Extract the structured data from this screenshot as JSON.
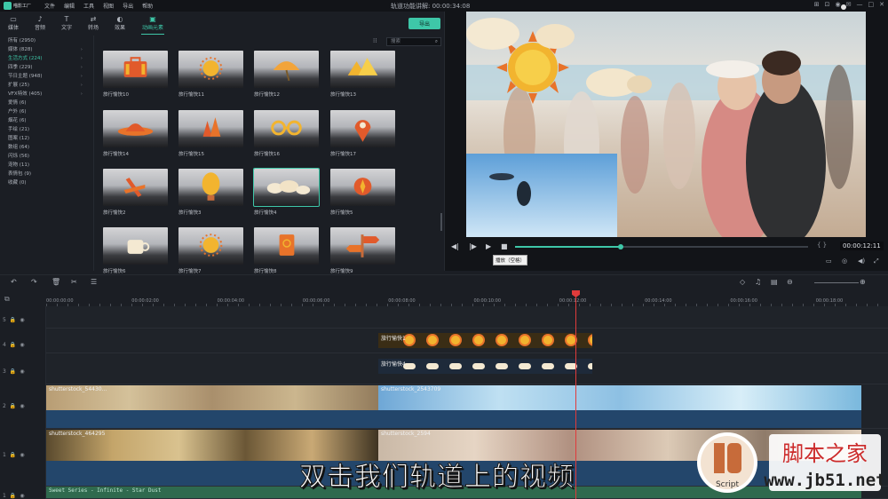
{
  "app": {
    "logo_text": "喵影工厂",
    "menu": [
      "文件",
      "编辑",
      "工具",
      "视图",
      "导出",
      "帮助"
    ],
    "doc_title": "轨道功能讲解: 00:00:34:08",
    "window_icons": [
      "cart-icon",
      "gift-icon",
      "user-icon",
      "mail-icon",
      "minimize-icon",
      "maximize-icon",
      "close-icon"
    ]
  },
  "tabs": [
    {
      "label": "媒体",
      "icon": "folder-icon"
    },
    {
      "label": "音频",
      "icon": "music-icon"
    },
    {
      "label": "文字",
      "icon": "text-icon"
    },
    {
      "label": "转场",
      "icon": "transition-icon"
    },
    {
      "label": "效果",
      "icon": "effects-icon"
    },
    {
      "label": "动画元素",
      "icon": "elements-icon",
      "active": true
    }
  ],
  "export_label": "导出",
  "search": {
    "placeholder": "搜索"
  },
  "categories": [
    {
      "label": "所有 (2950)",
      "arrow": false
    },
    {
      "label": "媒体 (828)",
      "arrow": true
    },
    {
      "label": "生活方式 (224)",
      "arrow": true,
      "active": true
    },
    {
      "label": "四季 (229)",
      "arrow": true
    },
    {
      "label": "节日主题 (948)",
      "arrow": true
    },
    {
      "label": "扩展 (25)",
      "arrow": true
    },
    {
      "label": "VFX特效 (405)",
      "arrow": true
    },
    {
      "label": "爱情 (6)",
      "arrow": false
    },
    {
      "label": "户外 (6)",
      "arrow": false
    },
    {
      "label": "烟花 (6)",
      "arrow": false
    },
    {
      "label": "手绘 (21)",
      "arrow": false
    },
    {
      "label": "图案 (12)",
      "arrow": false
    },
    {
      "label": "数组 (64)",
      "arrow": false
    },
    {
      "label": "闪烁 (56)",
      "arrow": false
    },
    {
      "label": "宠物 (11)",
      "arrow": false
    },
    {
      "label": "表情包 (9)",
      "arrow": false
    },
    {
      "label": "收藏 (0)",
      "arrow": false
    }
  ],
  "elements": [
    {
      "label": "旅行愉快10",
      "icon": "suitcase-icon"
    },
    {
      "label": "旅行愉快11",
      "icon": "sun-icon"
    },
    {
      "label": "旅行愉快12",
      "icon": "umbrella-icon"
    },
    {
      "label": "旅行愉快13",
      "icon": "mountains-icon"
    },
    {
      "label": "旅行愉快14",
      "icon": "hat-icon"
    },
    {
      "label": "旅行愉快15",
      "icon": "trees-icon"
    },
    {
      "label": "旅行愉快16",
      "icon": "sunglasses-icon"
    },
    {
      "label": "旅行愉快17",
      "icon": "location-pin-icon"
    },
    {
      "label": "旅行愉快2",
      "icon": "plane-icon"
    },
    {
      "label": "旅行愉快3",
      "icon": "balloon-icon"
    },
    {
      "label": "旅行愉快4",
      "icon": "clouds-icon",
      "selected": true
    },
    {
      "label": "旅行愉快5",
      "icon": "compass-icon"
    },
    {
      "label": "旅行愉快6",
      "icon": "cup-icon"
    },
    {
      "label": "旅行愉快7",
      "icon": "sun-icon"
    },
    {
      "label": "旅行愉快8",
      "icon": "passport-icon"
    },
    {
      "label": "旅行愉快9",
      "icon": "signpost-icon"
    }
  ],
  "preview": {
    "time": "00:00:12:11",
    "progress": 0.36,
    "tooltip": "播放（空格）",
    "controls": [
      "skip-back-icon",
      "play-back-icon",
      "play-icon",
      "stop-icon"
    ],
    "bottom_icons": [
      "monitor-icon",
      "snapshot-icon",
      "volume-icon",
      "fullscreen-icon"
    ]
  },
  "timeline": {
    "ruler": [
      "00:00:00:00",
      "00:00:02:00",
      "00:00:04:00",
      "00:00:06:00",
      "00:00:08:00",
      "00:00:10:00",
      "00:00:12:00",
      "00:00:14:00",
      "00:00:16:00",
      "00:00:18:00"
    ],
    "tracks": [
      "5",
      "4",
      "3",
      "2",
      "1",
      "1"
    ],
    "clips": {
      "elem1": "旅行愉快1",
      "elem2": "旅行愉快4",
      "video2a": "shutterstock_54430...",
      "video2b": "shutterstock_2543709",
      "video1a": "shutterstock_464295",
      "video1b": "shutterstock_2594",
      "audio": "Sweet Series - Infinite - Star Dust"
    }
  },
  "subtitle": "双击我们轨道上的视频",
  "watermark": {
    "brand": "脚本之家",
    "url": "www.jb51.net",
    "script_label": "Script",
    "logo_letters": "JB"
  },
  "colors": {
    "accent": "#3ec7a8",
    "playhead": "#e03b3b",
    "panel": "#1b1e24"
  }
}
